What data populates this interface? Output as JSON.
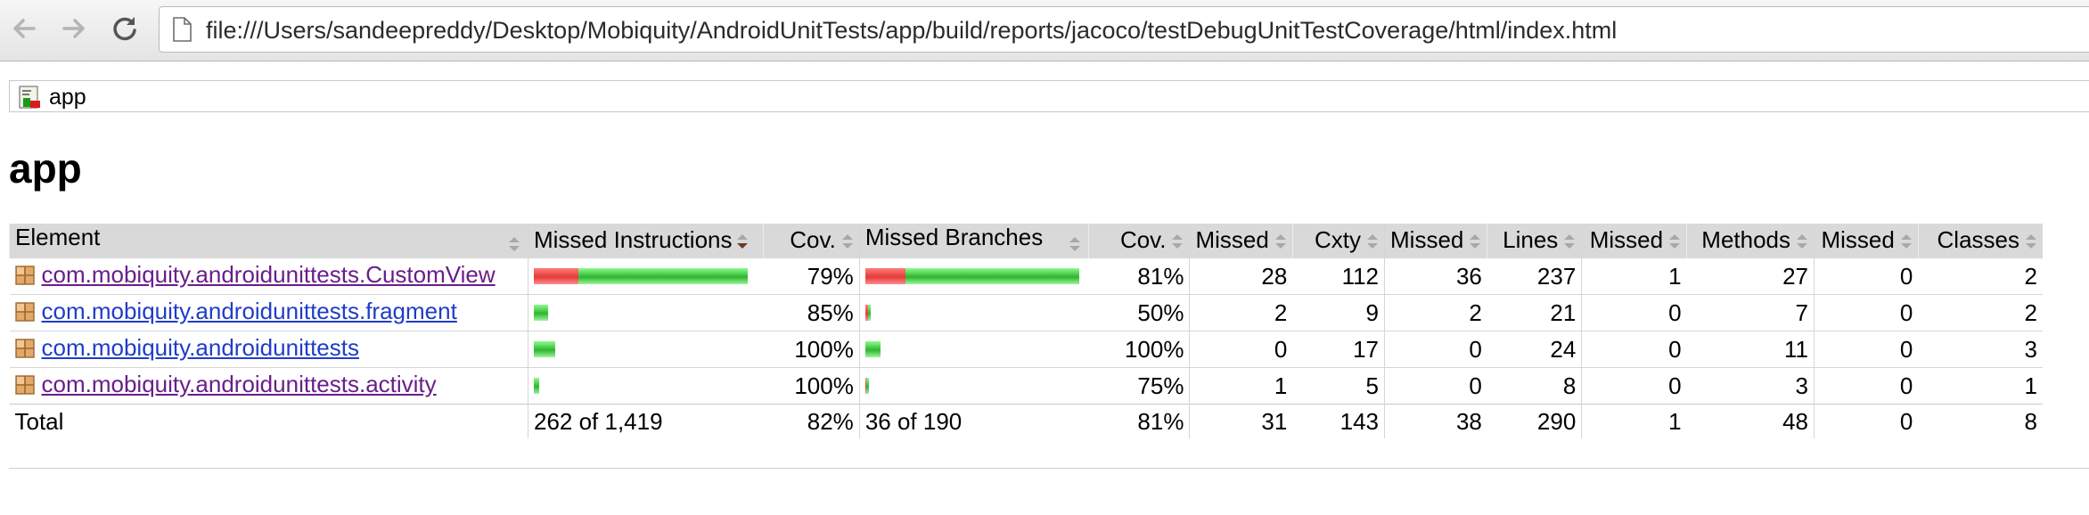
{
  "browser": {
    "url": "file:///Users/sandeepreddy/Desktop/Mobiquity/AndroidUnitTests/app/build/reports/jacoco/testDebugUnitTestCoverage/html/index.html"
  },
  "breadcrumb": {
    "label": "app"
  },
  "page_title": "app",
  "table": {
    "headers": {
      "element": "Element",
      "missed_instructions": "Missed Instructions",
      "cov1": "Cov.",
      "missed_branches": "Missed Branches",
      "cov2": "Cov.",
      "missed_cxty": "Missed",
      "cxty": "Cxty",
      "missed_lines": "Missed",
      "lines": "Lines",
      "missed_methods": "Missed",
      "methods": "Methods",
      "missed_classes": "Missed",
      "classes": "Classes"
    },
    "rows": [
      {
        "element": "com.mobiquity.androidunittests.CustomView",
        "visited": true,
        "instr_bar": {
          "red": 0.2071,
          "green": 0.7929
        },
        "cov1": "79%",
        "branch_bar": {
          "red": 0.1895,
          "green": 0.8105
        },
        "cov2": "81%",
        "missed_cxty": "28",
        "cxty": "112",
        "missed_lines": "36",
        "lines": "237",
        "missed_methods": "1",
        "methods": "27",
        "missed_classes": "0",
        "classes": "2"
      },
      {
        "element": "com.mobiquity.androidunittests.fragment",
        "visited": false,
        "instr_bar": {
          "red": 0.0,
          "green": 0.065
        },
        "cov1": "85%",
        "branch_bar": {
          "red": 0.0105,
          "green": 0.0105
        },
        "cov2": "50%",
        "missed_cxty": "2",
        "cxty": "9",
        "missed_lines": "2",
        "lines": "21",
        "missed_methods": "0",
        "methods": "7",
        "missed_classes": "0",
        "classes": "2"
      },
      {
        "element": "com.mobiquity.androidunittests",
        "visited": false,
        "instr_bar": {
          "red": 0.0,
          "green": 0.1
        },
        "cov1": "100%",
        "branch_bar": {
          "red": 0.0,
          "green": 0.07
        },
        "cov2": "100%",
        "missed_cxty": "0",
        "cxty": "17",
        "missed_lines": "0",
        "lines": "24",
        "missed_methods": "0",
        "methods": "11",
        "missed_classes": "0",
        "classes": "3"
      },
      {
        "element": "com.mobiquity.androidunittests.activity",
        "visited": true,
        "instr_bar": {
          "red": 0.0,
          "green": 0.025
        },
        "cov1": "100%",
        "branch_bar": {
          "red": 0.005,
          "green": 0.011
        },
        "cov2": "75%",
        "missed_cxty": "1",
        "cxty": "5",
        "missed_lines": "0",
        "lines": "8",
        "missed_methods": "0",
        "methods": "3",
        "missed_classes": "0",
        "classes": "1"
      }
    ],
    "total": {
      "label": "Total",
      "missed_instructions": "262 of 1,419",
      "cov1": "82%",
      "missed_branches": "36 of 190",
      "cov2": "81%",
      "missed_cxty": "31",
      "cxty": "143",
      "missed_lines": "38",
      "lines": "290",
      "missed_methods": "1",
      "methods": "48",
      "missed_classes": "0",
      "classes": "8"
    }
  },
  "icons": {
    "back": "back-arrow-icon",
    "forward": "forward-arrow-icon",
    "reload": "reload-icon",
    "page": "page-document-icon",
    "report": "report-icon",
    "package": "package-icon",
    "sort": "sort-icon"
  },
  "colors": {
    "link": "#1f3cc9",
    "visited_link": "#6a1d8a",
    "bar_red": "#e43a3a",
    "bar_green": "#2fb52f",
    "header_bg": "#d9d9d9"
  }
}
